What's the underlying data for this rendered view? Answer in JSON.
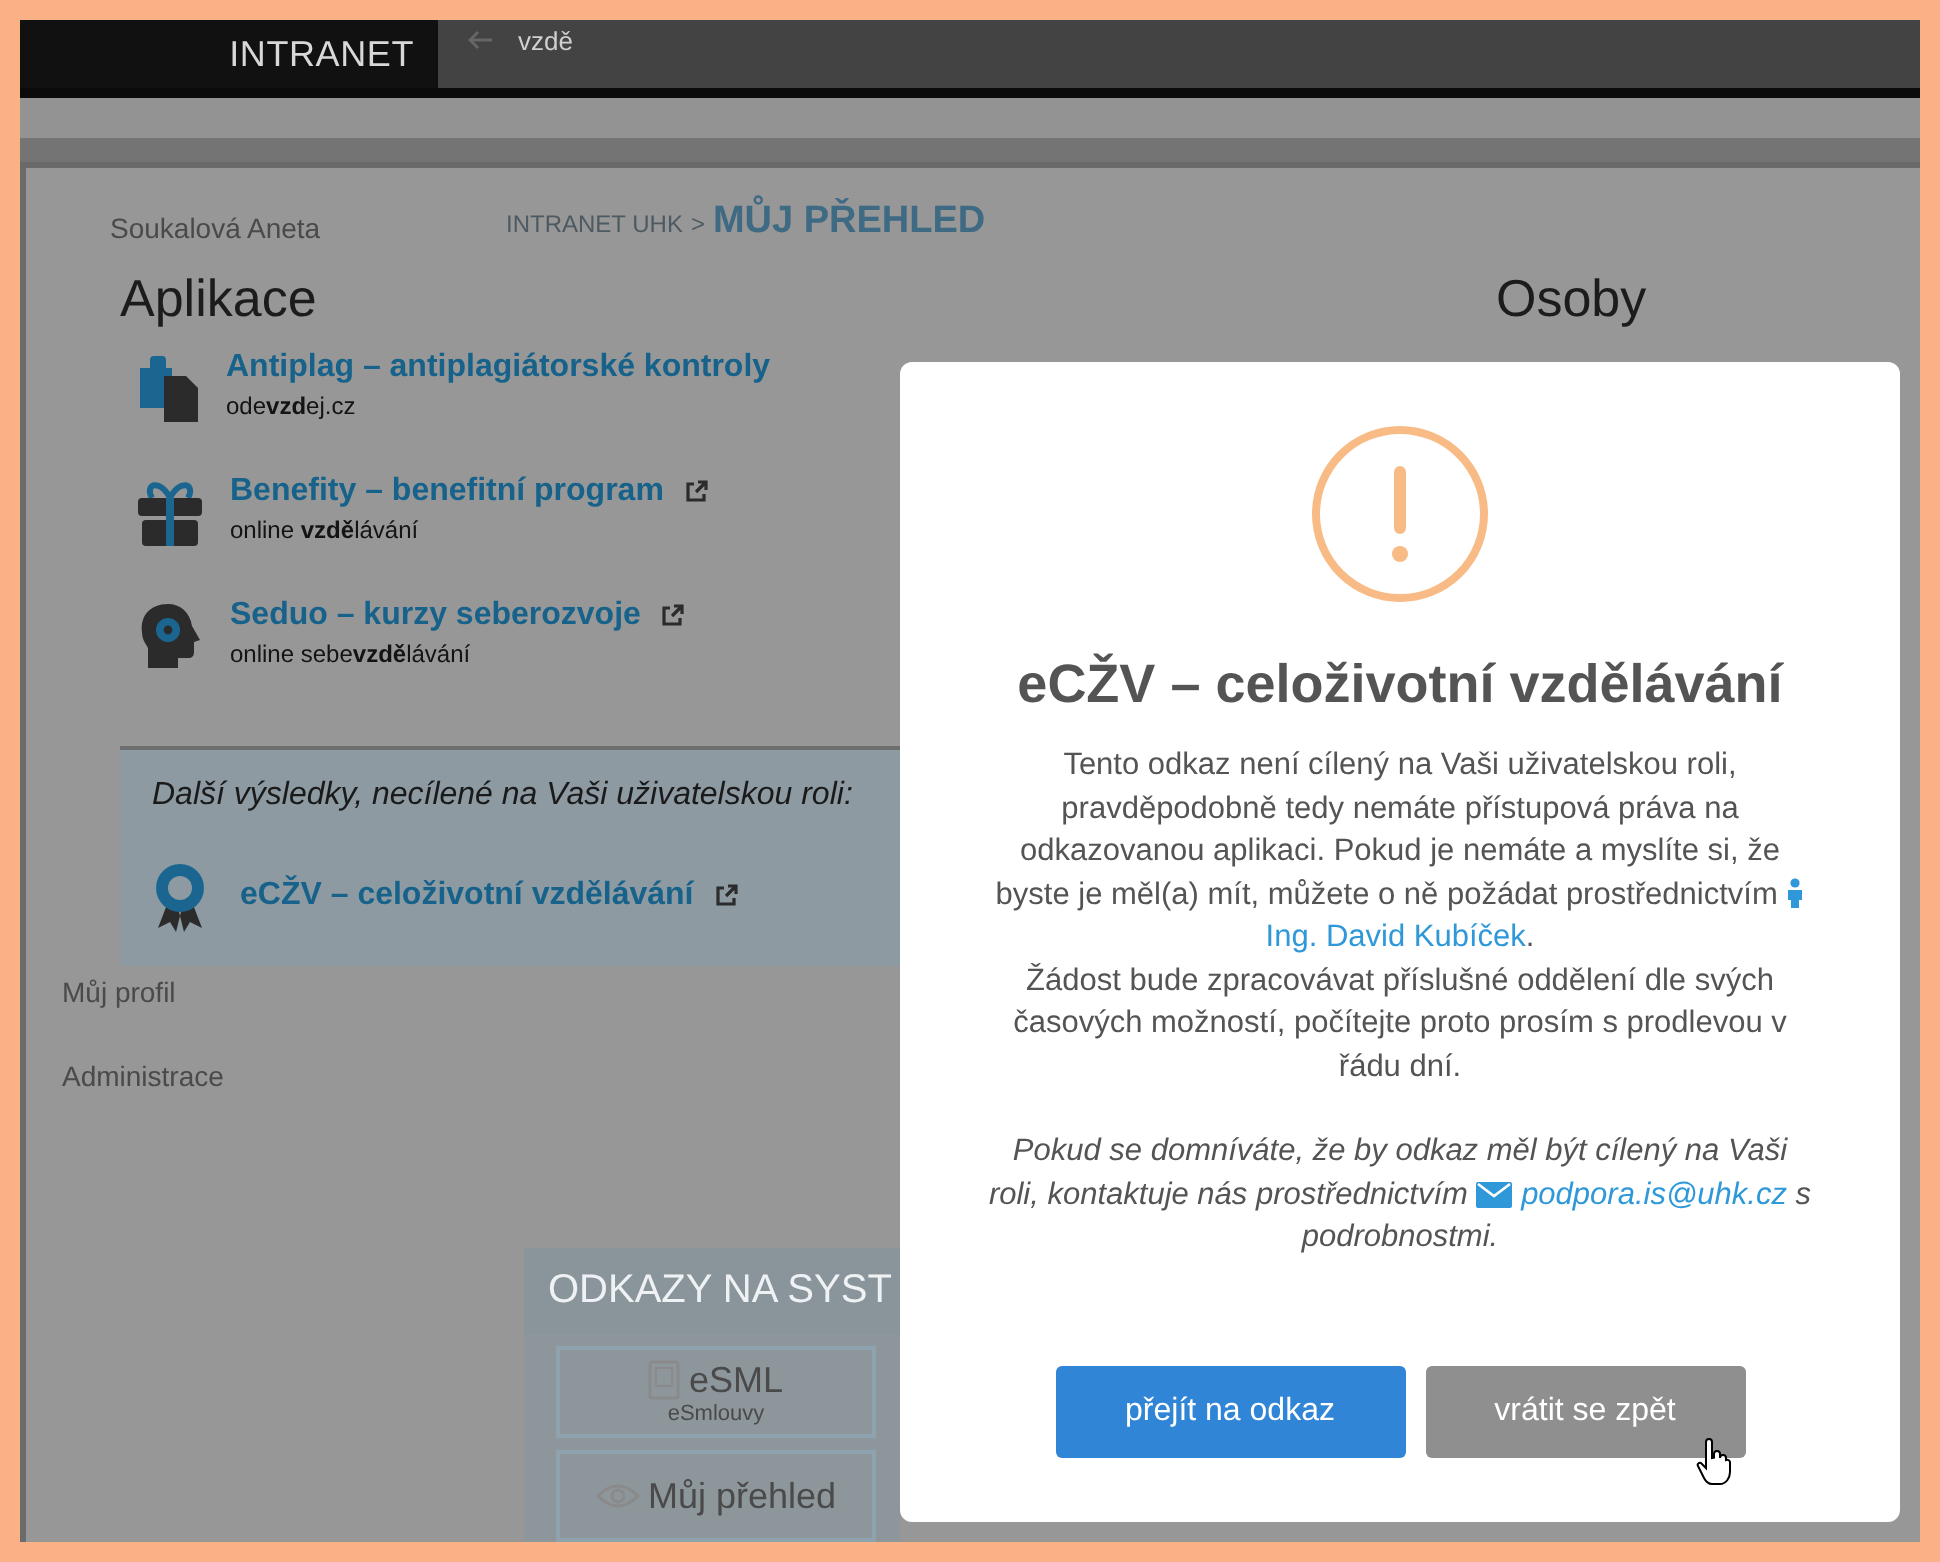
{
  "top_bar": {
    "logo": "INTRANET",
    "search_value": "vzdě"
  },
  "page": {
    "user_name": "Soukalová Aneta",
    "breadcrumb": {
      "parent": "INTRANET UHK",
      "separator": ">",
      "current": "MŮJ PŘEHLED"
    },
    "sidebar_items": [
      {
        "label": "Můj profil"
      },
      {
        "label": "Administrace"
      }
    ],
    "links_panel": {
      "title": "ODKAZY NA SYST",
      "cards": [
        {
          "title": "eSML",
          "subtitle": "eSmlouvy"
        },
        {
          "title": "Můj přehled"
        }
      ]
    }
  },
  "search_results": {
    "apps_heading": "Aplikace",
    "people_heading": "Osoby",
    "apps": [
      {
        "title": "Antiplag – antiplagiátorské kontroly",
        "subtitle": "ode**vzd**ej.cz",
        "external": false
      },
      {
        "title": "Benefity – benefitní program",
        "subtitle": "online **vzdě**lávání",
        "external": true
      },
      {
        "title": "Seduo – kurzy seberozvoje",
        "subtitle": "online sebe**vzdě**lávání",
        "external": true
      }
    ],
    "other_heading": "Další výsledky, necílené na Vaši uživatelskou roli:",
    "other_apps": [
      {
        "title": "eCŽV – celoživotní vzdělávání",
        "external": true
      }
    ]
  },
  "modal": {
    "title": "eCŽV – celoživotní vzdělávání",
    "paragraph_1": {
      "before": "Tento odkaz není cílený na Vaši uživatelskou roli, pravděpodobně tedy nemáte přístupová práva na odkazovanou aplikaci. Pokud je nemáte a myslíte si, že byste je měl(a) mít, můžete o ně požádat prostřednictvím",
      "link": "Ing. David Kubíček",
      "after": "."
    },
    "paragraph_2": "Žádost bude zpracovávat příslušné oddělení dle svých časových možností, počítejte proto prosím s prodlevou v řádu dní.",
    "paragraph_3": {
      "before": "Pokud se domníváte, že by odkaz měl být cílený na Vaši roli, kontaktuje nás prostřednictvím",
      "link": "podpora.is@uhk.cz",
      "after": "s podrobnostmi."
    },
    "buttons": [
      {
        "label": "přejít na odkaz",
        "kind": "primary"
      },
      {
        "label": "vrátit se zpět",
        "kind": "secondary"
      }
    ]
  }
}
